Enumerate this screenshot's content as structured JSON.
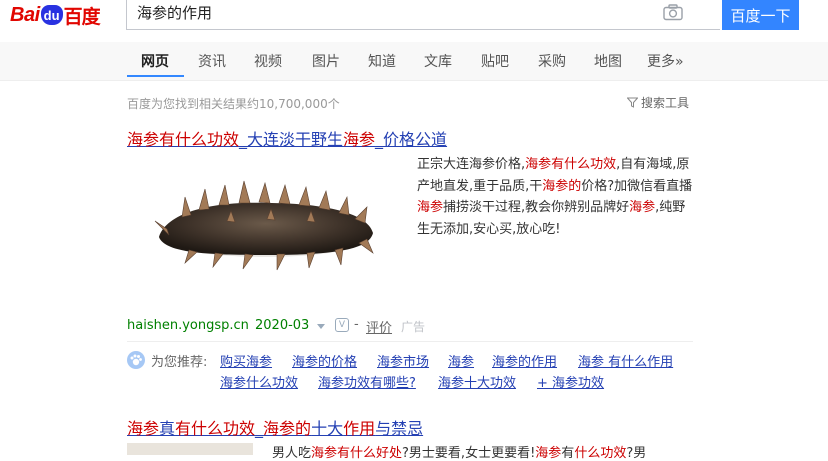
{
  "header": {
    "logo_text_a": "Bai",
    "logo_text_b": "du",
    "logo_text_c": "百度",
    "query": "海参的作用",
    "search_button": "百度一下"
  },
  "tabs": [
    "网页",
    "资讯",
    "视频",
    "图片",
    "知道",
    "文库",
    "贴吧",
    "采购",
    "地图",
    "更多»"
  ],
  "active_tab": "网页",
  "result_count": "百度为您找到相关结果约10,700,000个",
  "search_tools": "搜索工具",
  "result1": {
    "title_a": "海参有什么功效",
    "title_b": "_大连淡干野生",
    "title_c": "海参",
    "title_d": "_价格公道",
    "desc_1": "正宗大连海参价格,",
    "desc_2": "海参有什么功效",
    "desc_3": ",自有海域,原产地直发,重于品质,干",
    "desc_4": "海参的",
    "desc_5": "价格?加微信看直播",
    "desc_6": "海参",
    "desc_7": "捕捞淡干过程,教会你辨别品牌好",
    "desc_8": "海参",
    "desc_9": ",纯野生无添加,安心买,放心吃!",
    "url": "haishen.yongsp.cn",
    "date": "2020-03",
    "v_badge": "V",
    "dash": "-",
    "rate": "评价",
    "ad": "广告"
  },
  "recommend": {
    "label": "为您推荐:",
    "links": [
      "购买海参",
      "海参的价格",
      "海参市场",
      "海参",
      "海参的作用",
      "海参 有什么作用",
      "海参什么功效",
      "海参功效有哪些?",
      "海参十大功效",
      "+ 海参功效"
    ]
  },
  "result2": {
    "title_a": "海参",
    "title_b": "真",
    "title_c": "有什么功效",
    "title_d": "_",
    "title_e": "海参的",
    "title_f": "十大",
    "title_g": "作用",
    "title_h": "与禁忌",
    "desc_1": "男人吃",
    "desc_2": "海参有什么好处",
    "desc_3": "?男士要看,女士更要看!",
    "desc_4": "海参",
    "desc_5": "有",
    "desc_6": "什么功效",
    "desc_7": "?男"
  },
  "colors": {
    "accent": "#3385ff",
    "link": "#2440b3",
    "highlight": "#cc0000",
    "url": "#008000"
  }
}
